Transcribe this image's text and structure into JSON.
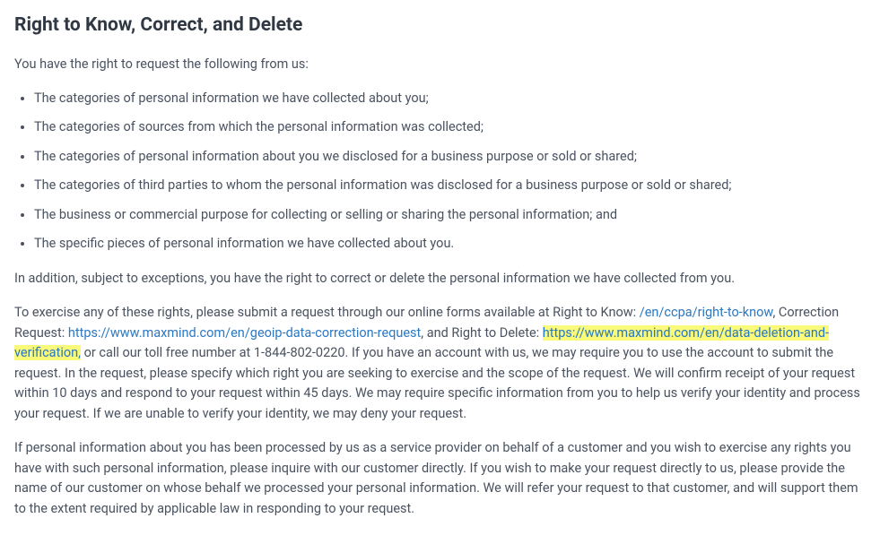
{
  "heading": "Right to Know, Correct, and Delete",
  "intro": "You have the right to request the following from us:",
  "bullets": [
    "The categories of personal information we have collected about you;",
    "The categories of sources from which the personal information was collected;",
    "The categories of personal information about you we disclosed for a business purpose or sold or shared;",
    "The categories of third parties to whom the personal information was disclosed for a business purpose or sold or shared;",
    "The business or commercial purpose for collecting or selling or sharing the personal information; and",
    "The specific pieces of personal information we have collected about you."
  ],
  "addition": "In addition, subject to exceptions, you have the right to correct or delete the personal information we have collected from you.",
  "exercise": {
    "lead": "To exercise any of these rights, please submit a request through our online forms available at Right to Know: ",
    "link1": "/en/ccpa/right-to-know",
    "mid1": ", Correction Request: ",
    "link2": "https://www.maxmind.com/en/geoip-data-correction-request",
    "mid2": ", and Right to Delete: ",
    "link3": "https://www.maxmind.com/en/data-deletion-and-verification,",
    "tail": " or call our toll free number at 1-844-802-0220. If you have an account with us, we may require you to use the account to submit the request. In the request, please specify which right you are seeking to exercise and the scope of the request. We will confirm receipt of your request within 10 days and respond to your request within 45 days. We may require specific information from you to help us verify your identity and process your request. If we are unable to verify your identity, we may deny your request."
  },
  "serviceProvider": "If personal information about you has been processed by us as a service provider on behalf of a customer and you wish to exercise any rights you have with such personal information, please inquire with our customer directly. If you wish to make your request directly to us, please provide the name of our customer on whose behalf we processed your personal information. We will refer your request to that customer, and will support them to the extent required by applicable law in responding to your request."
}
